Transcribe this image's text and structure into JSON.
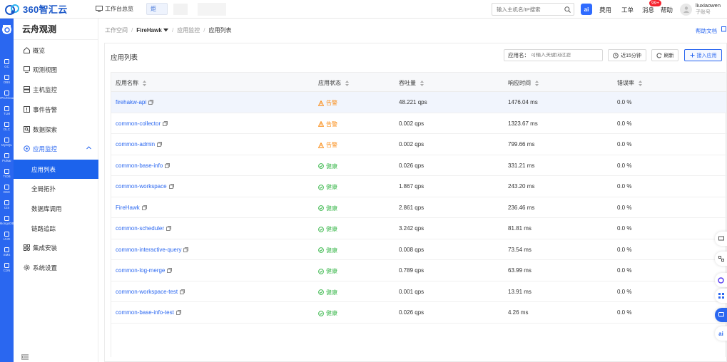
{
  "topbar": {
    "brand": "360智汇云",
    "workbench": "工作台总览",
    "tab_fragment": "炬",
    "search_placeholder": "输入主机名/IP搜索",
    "ai_label": "ai",
    "nav": [
      "费用",
      "工单",
      "消息",
      "帮助"
    ],
    "message_badge": "99+",
    "user_name": "liuxiaowen",
    "user_role": "子账号"
  },
  "rail": {
    "items": [
      "GC",
      "OBS",
      "VPC/Cloud",
      "TLM",
      "DLC",
      "MySQL",
      "Pulsar",
      "TIDB",
      "DSC",
      "CIS",
      "MongoDB",
      "LIVE",
      "SMS",
      "CDN"
    ]
  },
  "sidebar": {
    "title": "云舟观测",
    "items": [
      {
        "label": "概览",
        "icon": "home-icon"
      },
      {
        "label": "观测视图",
        "icon": "monitor-icon"
      },
      {
        "label": "主机监控",
        "icon": "server-icon"
      },
      {
        "label": "事件告警",
        "icon": "alarm-icon"
      },
      {
        "label": "数据探索",
        "icon": "explore-icon"
      },
      {
        "label": "应用监控",
        "icon": "app-monitor-icon"
      },
      {
        "label": "应用列表",
        "icon": ""
      },
      {
        "label": "全局拓扑",
        "icon": ""
      },
      {
        "label": "数据库调用",
        "icon": ""
      },
      {
        "label": "链路追踪",
        "icon": ""
      },
      {
        "label": "集成安装",
        "icon": "grid-icon"
      },
      {
        "label": "系统设置",
        "icon": "gear-icon"
      }
    ]
  },
  "breadcrumb": {
    "workspace": "工作空间",
    "project": "FireHawk",
    "section": "应用监控",
    "current": "应用列表"
  },
  "help_doc": "帮助文档",
  "panel": {
    "title": "应用列表",
    "filter_label": "应用名：",
    "filter_placeholder": "可输入关键词过滤",
    "time_button": "近15分钟",
    "refresh_button": "刷新",
    "add_button": "接入应用"
  },
  "table": {
    "headers": [
      "应用名称",
      "应用状态",
      "吞吐量",
      "响应时间",
      "错误率"
    ],
    "rows": [
      {
        "name": "firehakw-api",
        "status": "告警",
        "level": "warn",
        "throughput": "48.221 qps",
        "latency": "1476.04 ms",
        "error": "0.0 %"
      },
      {
        "name": "common-collector",
        "status": "告警",
        "level": "warn",
        "throughput": "0.002 qps",
        "latency": "1323.67 ms",
        "error": "0.0 %"
      },
      {
        "name": "common-admin",
        "status": "告警",
        "level": "warn",
        "throughput": "0.002 qps",
        "latency": "799.66 ms",
        "error": "0.0 %"
      },
      {
        "name": "common-base-info",
        "status": "健康",
        "level": "ok",
        "throughput": "0.026 qps",
        "latency": "331.21 ms",
        "error": "0.0 %"
      },
      {
        "name": "common-workspace",
        "status": "健康",
        "level": "ok",
        "throughput": "1.867 qps",
        "latency": "243.20 ms",
        "error": "0.0 %"
      },
      {
        "name": "FireHawk",
        "status": "健康",
        "level": "ok",
        "throughput": "2.861 qps",
        "latency": "236.46 ms",
        "error": "0.0 %"
      },
      {
        "name": "common-scheduler",
        "status": "健康",
        "level": "ok",
        "throughput": "3.242 qps",
        "latency": "81.81 ms",
        "error": "0.0 %"
      },
      {
        "name": "common-interactive-query",
        "status": "健康",
        "level": "ok",
        "throughput": "0.008 qps",
        "latency": "73.54 ms",
        "error": "0.0 %"
      },
      {
        "name": "common-log-merge",
        "status": "健康",
        "level": "ok",
        "throughput": "0.789 qps",
        "latency": "63.99 ms",
        "error": "0.0 %"
      },
      {
        "name": "common-workspace-test",
        "status": "健康",
        "level": "ok",
        "throughput": "0.001 qps",
        "latency": "13.91 ms",
        "error": "0.0 %"
      },
      {
        "name": "common-base-info-test",
        "status": "健康",
        "level": "ok",
        "throughput": "0.026 qps",
        "latency": "4.26 ms",
        "error": "0.0 %"
      }
    ]
  },
  "colors": {
    "accent": "#2a67f0",
    "warn": "#fa8c16",
    "ok": "#3fb950",
    "badge": "#f5222d"
  }
}
